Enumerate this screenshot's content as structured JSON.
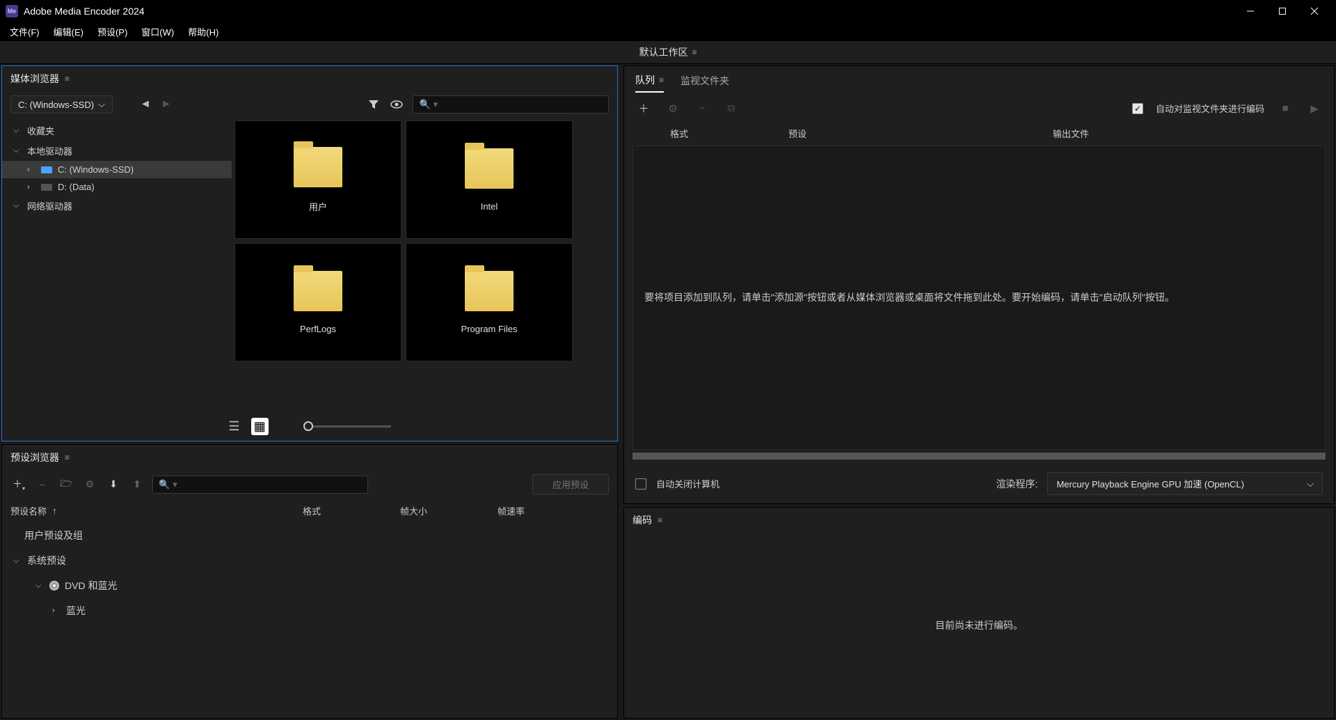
{
  "app": {
    "icon_text": "Me",
    "title": "Adobe Media Encoder 2024"
  },
  "menubar": [
    "文件(F)",
    "编辑(E)",
    "预设(P)",
    "窗口(W)",
    "帮助(H)"
  ],
  "workspace": {
    "label": "默认工作区"
  },
  "media_browser": {
    "title": "媒体浏览器",
    "drive_selected": "C: (Windows-SSD)",
    "tree": {
      "favorites": "收藏夹",
      "local_drives": "本地驱动器",
      "drive_c": "C: (Windows-SSD)",
      "drive_d": "D: (Data)",
      "network_drives": "网络驱动器"
    },
    "folders": [
      "用户",
      "Intel",
      "PerfLogs",
      "Program Files"
    ]
  },
  "preset_browser": {
    "title": "预设浏览器",
    "apply_label": "应用预设",
    "columns": {
      "name": "预设名称",
      "format": "格式",
      "frame_size": "帧大小",
      "frame_rate": "帧速率"
    },
    "items": {
      "user_presets": "用户预设及组",
      "system_presets": "系统预设",
      "dvd_bluray": "DVD 和蓝光",
      "bluray": "蓝光"
    }
  },
  "queue": {
    "tabs": {
      "queue": "队列",
      "watch": "监视文件夹"
    },
    "auto_encode_label": "自动对监视文件夹进行编码",
    "columns": {
      "format": "格式",
      "preset": "预设",
      "output": "输出文件"
    },
    "empty_message": "要将项目添加到队列，请单击\"添加源\"按钮或者从媒体浏览器或桌面将文件拖到此处。要开始编码，请单击\"启动队列\"按钮。",
    "auto_shutdown": "自动关闭计算机",
    "renderer_label": "渲染程序:",
    "renderer_value": "Mercury Playback Engine GPU 加速 (OpenCL)"
  },
  "encoding": {
    "title": "编码",
    "idle_message": "目前尚未进行编码。"
  }
}
